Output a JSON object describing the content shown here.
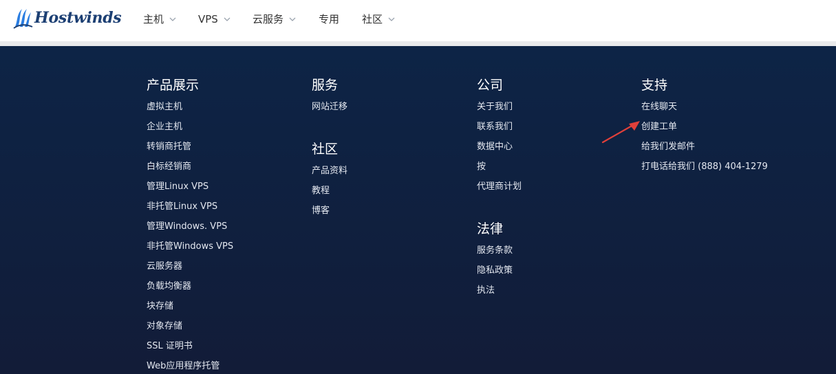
{
  "brand": {
    "name": "Hostwinds",
    "accent": "#1c3f73",
    "icon": "hostwinds-wave-logo"
  },
  "nav": [
    {
      "label": "主机",
      "dropdown": true
    },
    {
      "label": "VPS",
      "dropdown": true
    },
    {
      "label": "云服务",
      "dropdown": true
    },
    {
      "label": "专用",
      "dropdown": false
    },
    {
      "label": "社区",
      "dropdown": true
    }
  ],
  "footer": {
    "background": "#0d2446",
    "products": {
      "heading": "产品展示",
      "links": [
        "虚拟主机",
        "企业主机",
        "转销商托管",
        "白标经销商",
        "管理Linux VPS",
        "非托管Linux VPS",
        "管理Windows. VPS",
        "非托管Windows VPS",
        "云服务器",
        "负载均衡器",
        "块存储",
        "对象存储",
        "SSL 证明书",
        "Web应用程序托管"
      ]
    },
    "services": {
      "heading": "服务",
      "links": [
        "网站迁移"
      ]
    },
    "community": {
      "heading": "社区",
      "links": [
        "产品资料",
        "教程",
        "博客"
      ]
    },
    "company": {
      "heading": "公司",
      "links": [
        "关于我们",
        "联系我们",
        "数据中心",
        "按",
        "代理商计划"
      ]
    },
    "legal": {
      "heading": "法律",
      "links": [
        "服务条款",
        "隐私政策",
        "执法"
      ]
    },
    "support": {
      "heading": "支持",
      "links": [
        "在线聊天",
        "创建工单",
        "给我们发邮件",
        "打电话给我们 (888) 404-1279"
      ]
    }
  },
  "annotation": {
    "icon": "red-pointer-arrow",
    "color": "#e0403a"
  }
}
